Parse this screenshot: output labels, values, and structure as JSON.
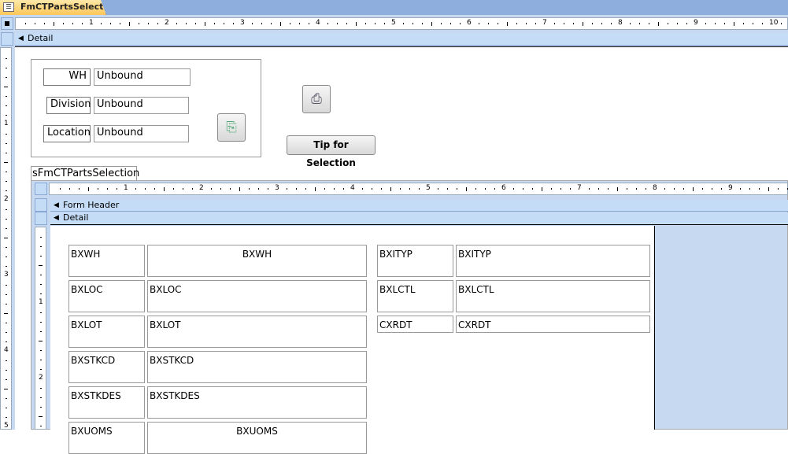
{
  "tab": {
    "title": "FmCTPartsSelection"
  },
  "main_ruler": {
    "numbers": [
      "1",
      "2",
      "3",
      "4",
      "5",
      "6",
      "7",
      "8",
      "9",
      "10"
    ]
  },
  "left_ruler": {
    "numbers": [
      "1",
      "2",
      "3",
      "4",
      "5"
    ]
  },
  "sections": {
    "detail": "Detail"
  },
  "filters": [
    {
      "label": "WH",
      "value": "Unbound"
    },
    {
      "label": "Division",
      "value": "Unbound"
    },
    {
      "label": "Location",
      "value": "Unbound"
    }
  ],
  "buttons": {
    "tip": "Tip for Selection",
    "refresh_icon": "refresh-pages-icon",
    "print_icon": "printer-icon"
  },
  "subform": {
    "label": "sFmCTPartsSelection",
    "ruler_numbers": [
      "1",
      "2",
      "3",
      "4",
      "5",
      "6",
      "7",
      "8",
      "9"
    ],
    "left_numbers": [
      "1",
      "2"
    ],
    "form_header": "Form Header",
    "detail": "Detail",
    "left_fields": [
      {
        "label": "BXWH",
        "value": "BXWH"
      },
      {
        "label": "BXLOC",
        "value": "BXLOC"
      },
      {
        "label": "BXLOT",
        "value": "BXLOT"
      },
      {
        "label": "BXSTKCD",
        "value": "BXSTKCD"
      },
      {
        "label": "BXSTKDES",
        "value": "BXSTKDES"
      },
      {
        "label": "BXUOMS",
        "value": "BXUOMS"
      }
    ],
    "right_fields": [
      {
        "label": "BXITYP",
        "value": "BXITYP"
      },
      {
        "label": "BXLCTL",
        "value": "BXLCTL"
      },
      {
        "label": "CXRDT",
        "value": "CXRDT"
      }
    ]
  }
}
